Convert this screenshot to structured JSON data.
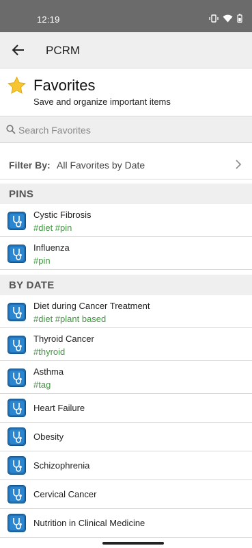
{
  "status": {
    "time": "12:19"
  },
  "appbar": {
    "title": "PCRM"
  },
  "favorites": {
    "title": "Favorites",
    "subtitle": "Save and organize important items"
  },
  "search": {
    "placeholder": "Search Favorites"
  },
  "filter": {
    "label": "Filter By:",
    "value": "All Favorites by Date"
  },
  "pins": {
    "header": "PINS",
    "items": [
      {
        "name": "Cystic Fibrosis",
        "tags": "#diet #pin"
      },
      {
        "name": "Influenza",
        "tags": "#pin"
      }
    ]
  },
  "by_date": {
    "header": "BY DATE",
    "items": [
      {
        "name": "Diet during Cancer Treatment",
        "tags": "#diet #plant based"
      },
      {
        "name": "Thyroid Cancer",
        "tags": "#thyroid"
      },
      {
        "name": "Asthma",
        "tags": "#tag"
      },
      {
        "name": "Heart Failure"
      },
      {
        "name": "Obesity"
      },
      {
        "name": "Schizophrenia"
      },
      {
        "name": "Cervical Cancer"
      },
      {
        "name": "Nutrition in Clinical Medicine"
      }
    ]
  },
  "colors": {
    "tag": "#3e9a3e",
    "icon_bg": "#1f6fb2",
    "statusbar": "#6b6b6b"
  },
  "icons": {
    "back": "arrow-left-icon",
    "star": "star-icon",
    "search": "search-icon",
    "chevron": "chevron-right-icon",
    "item": "stethoscope-icon"
  }
}
